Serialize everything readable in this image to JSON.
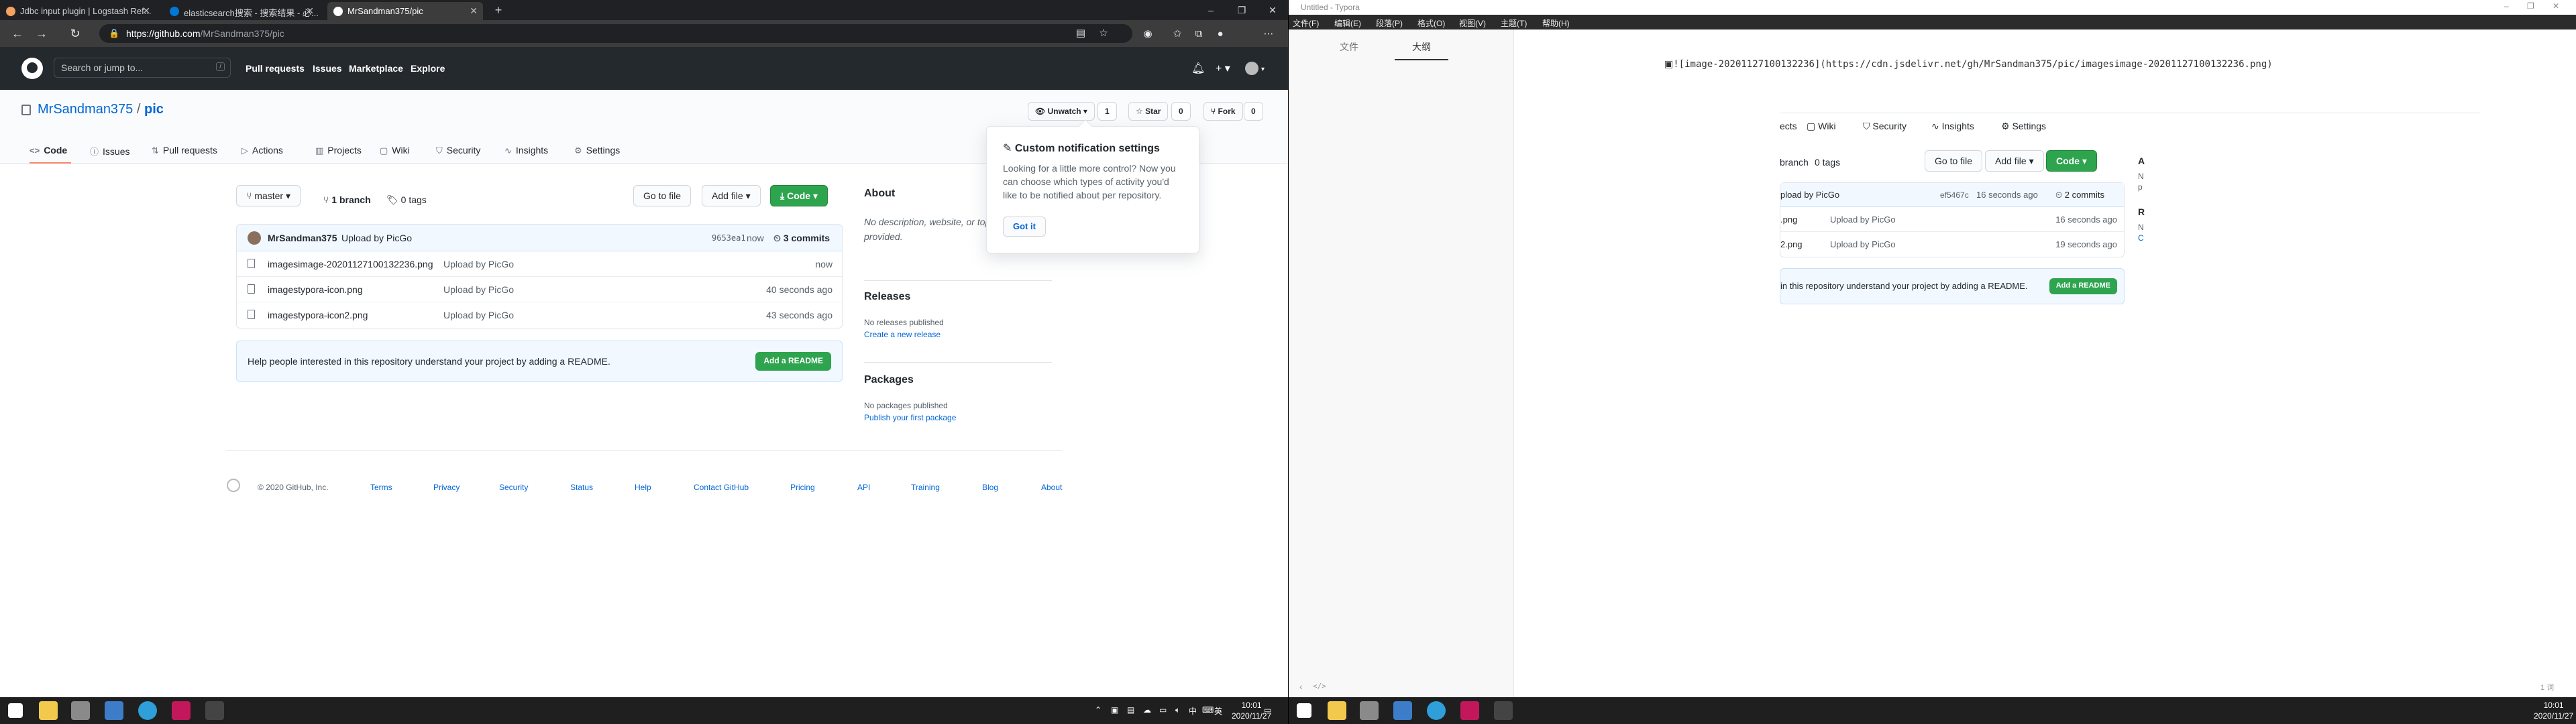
{
  "browser": {
    "tabs": [
      {
        "title": "Jdbc input plugin | Logstash Ref...",
        "active": false
      },
      {
        "title": "elasticsearch搜索 - 搜索结果 - 必...",
        "active": false
      },
      {
        "title": "MrSandman375/pic",
        "active": true
      }
    ],
    "new_tab": "+",
    "url_domain": "https://github.com",
    "url_path": "/MrSandman375/pic"
  },
  "github": {
    "search_placeholder": "Search or jump to...",
    "search_shortcut": "/",
    "nav": [
      "Pull requests",
      "Issues",
      "Marketplace",
      "Explore"
    ]
  },
  "repo": {
    "owner": "MrSandman375",
    "separator": "/",
    "name": "pic",
    "watch_label": "Unwatch",
    "watch_count": "1",
    "star_label": "Star",
    "star_count": "0",
    "fork_label": "Fork",
    "fork_count": "0",
    "tabs": [
      "Code",
      "Issues",
      "Pull requests",
      "Actions",
      "Projects",
      "Wiki",
      "Security",
      "Insights",
      "Settings"
    ],
    "branch": "master",
    "branches": "1 branch",
    "tags": "0 tags",
    "go_to_file": "Go to file",
    "add_file": "Add file",
    "code_btn": "Code",
    "commit": {
      "author": "MrSandman375",
      "message": "Upload by PicGo",
      "sha": "9653ea1",
      "time": "now",
      "count": "3 commits"
    },
    "files": [
      {
        "name": "imagesimage-20201127100132236.png",
        "message": "Upload by PicGo",
        "time": "now"
      },
      {
        "name": "imagestypora-icon.png",
        "message": "Upload by PicGo",
        "time": "40 seconds ago"
      },
      {
        "name": "imagestypora-icon2.png",
        "message": "Upload by PicGo",
        "time": "43 seconds ago"
      }
    ],
    "readme_text": "Help people interested in this repository understand your project by adding a README.",
    "readme_btn": "Add a README"
  },
  "sidebar": {
    "about_h": "About",
    "about_text": "No description, website, or topics provided.",
    "releases_h": "Releases",
    "releases_text": "No releases published",
    "releases_link": "Create a new release",
    "packages_h": "Packages",
    "packages_text": "No packages published",
    "packages_link": "Publish your first package"
  },
  "popover": {
    "title": "Custom notification settings",
    "body": "Looking for a little more control? Now you can choose which types of activity you'd like to be notified about per repository.",
    "button": "Got it"
  },
  "footer": {
    "copyright": "© 2020 GitHub, Inc.",
    "links": [
      "Terms",
      "Privacy",
      "Security",
      "Status",
      "Help",
      "Contact GitHub",
      "Pricing",
      "API",
      "Training",
      "Blog",
      "About"
    ]
  },
  "taskbar_left": {
    "time": "10:01",
    "date": "2020/11/27",
    "ime": "中",
    "lang": "英"
  },
  "typora": {
    "title": "Untitled - Typora",
    "menu": [
      "文件(F)",
      "编辑(E)",
      "段落(P)",
      "格式(O)",
      "视图(V)",
      "主题(T)",
      "帮助(H)"
    ],
    "sidebar_tabs": [
      "文件",
      "大纲"
    ],
    "markdown": "![image-20201127100132236](https://cdn.jsdelivr.net/gh/MrSandman375/pic/imagesimage-20201127100132236.png)",
    "word_count": "1 词",
    "code_toggle": "</>",
    "nav_back": "‹",
    "preview": {
      "tabs": [
        "ects",
        "Wiki",
        "Security",
        "Insights",
        "Settings"
      ],
      "branch": "branch",
      "tags": "0 tags",
      "go_to_file": "Go to file",
      "add_file": "Add file",
      "code_btn": "Code",
      "commit_msg": "pload by PicGo",
      "sha": "ef5467c",
      "commit_time": "16 seconds ago",
      "commits": "2 commits",
      "rows": [
        {
          "name": ".png",
          "message": "Upload by PicGo",
          "time": "16 seconds ago"
        },
        {
          "name": "2.png",
          "message": "Upload by PicGo",
          "time": "19 seconds ago"
        }
      ],
      "readme_text": "in this repository understand your project by adding a README.",
      "readme_btn": "Add a README",
      "side_a": "A",
      "side_n": "N",
      "side_p": "p",
      "side_r": "R",
      "side_n2": "N",
      "side_c": "C"
    }
  },
  "taskbar_right": {
    "time": "10:01",
    "date": "2020/11/27"
  }
}
